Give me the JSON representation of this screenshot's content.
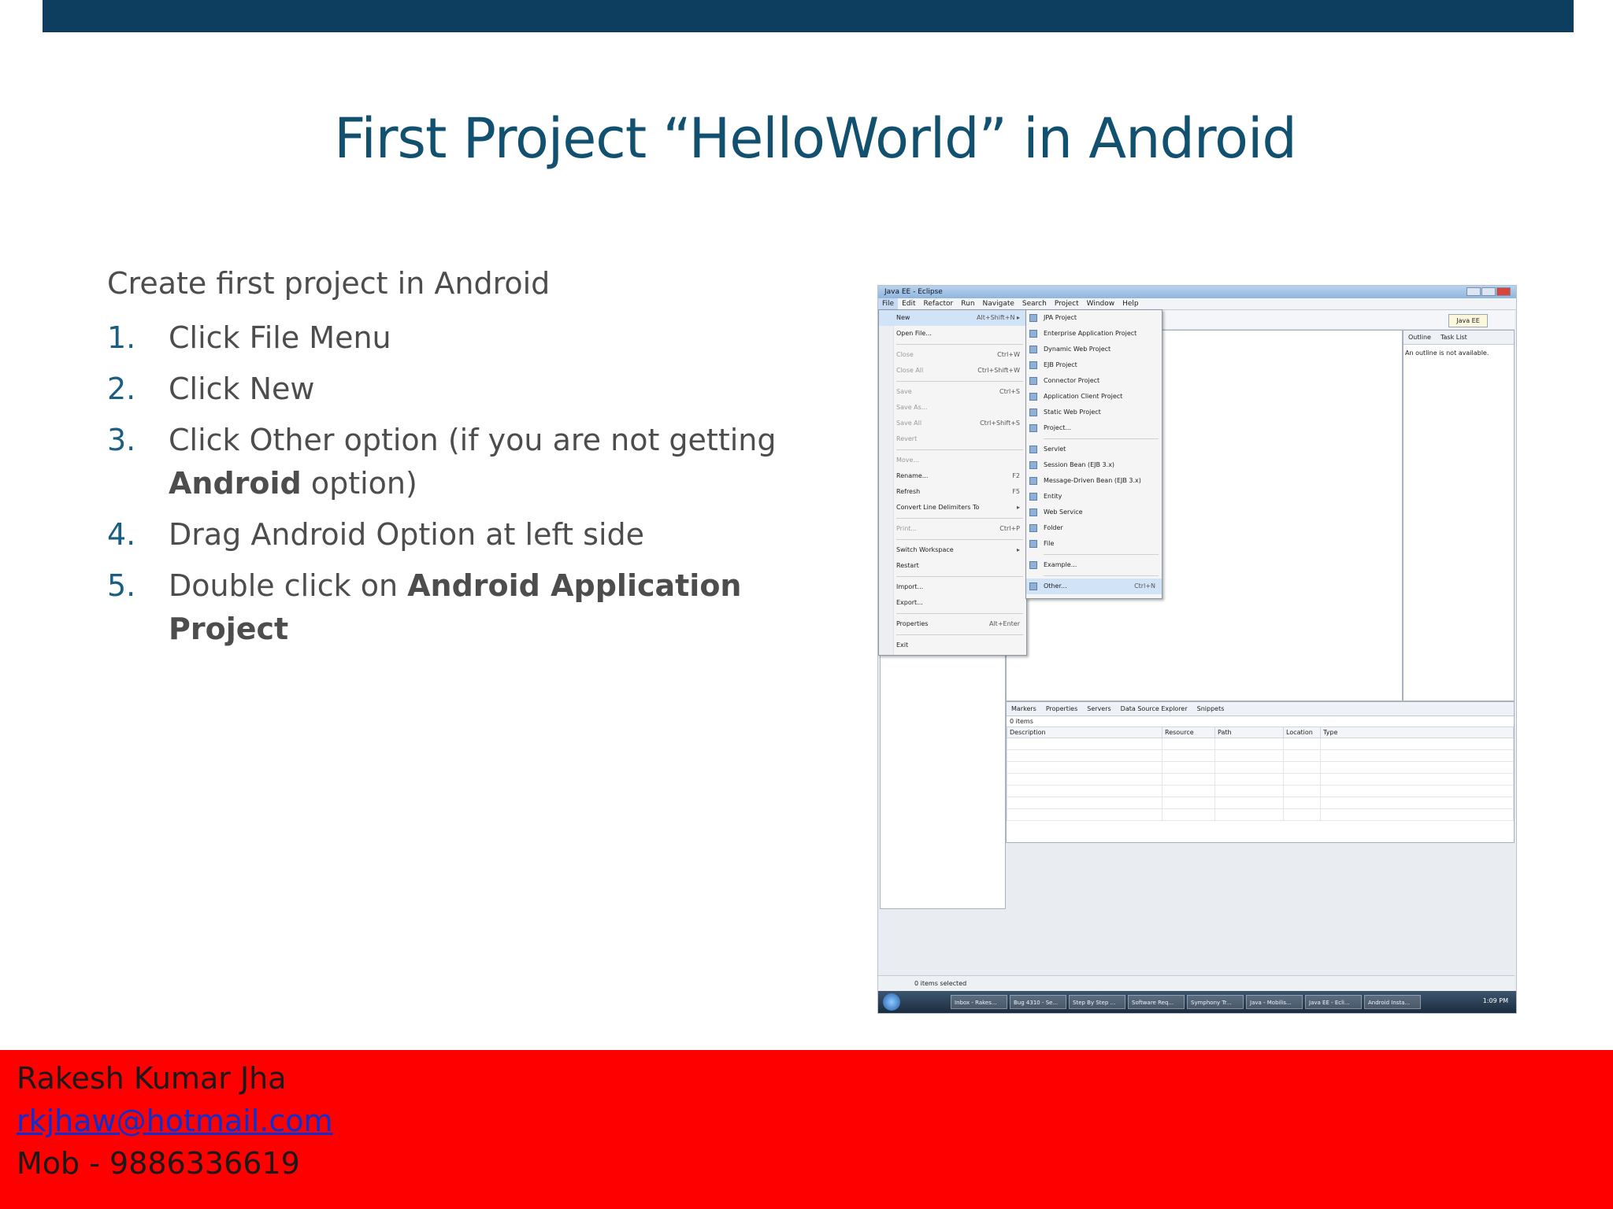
{
  "slide": {
    "title": "First Project “HelloWorld” in Android",
    "intro": "Create first project in Android",
    "steps": [
      {
        "num": "1.",
        "pre": "Click File Menu",
        "bold": "",
        "post": ""
      },
      {
        "num": "2.",
        "pre": "Click New",
        "bold": "",
        "post": ""
      },
      {
        "num": "3.",
        "pre": "Click Other option (if you are not getting ",
        "bold": "Android",
        "post": " option)"
      },
      {
        "num": "4.",
        "pre": "Drag Android Option at left side",
        "bold": "",
        "post": ""
      },
      {
        "num": "5.",
        "pre": "Double click on ",
        "bold": "Android Application Project",
        "post": ""
      }
    ]
  },
  "screenshot": {
    "window_title": "Java EE - Eclipse",
    "menubar": [
      "File",
      "Edit",
      "Refactor",
      "Run",
      "Navigate",
      "Search",
      "Project",
      "Window",
      "Help"
    ],
    "perspective": "Java EE",
    "file_menu": [
      {
        "label": "New",
        "shortcut": "Alt+Shift+N ▸",
        "state": "hl"
      },
      {
        "label": "Open File...",
        "shortcut": "",
        "state": ""
      },
      {
        "sep": true
      },
      {
        "label": "Close",
        "shortcut": "Ctrl+W",
        "state": "dis"
      },
      {
        "label": "Close All",
        "shortcut": "Ctrl+Shift+W",
        "state": "dis"
      },
      {
        "sep": true
      },
      {
        "label": "Save",
        "shortcut": "Ctrl+S",
        "state": "dis"
      },
      {
        "label": "Save As...",
        "shortcut": "",
        "state": "dis"
      },
      {
        "label": "Save All",
        "shortcut": "Ctrl+Shift+S",
        "state": "dis"
      },
      {
        "label": "Revert",
        "shortcut": "",
        "state": "dis"
      },
      {
        "sep": true
      },
      {
        "label": "Move...",
        "shortcut": "",
        "state": "dis"
      },
      {
        "label": "Rename...",
        "shortcut": "F2",
        "state": ""
      },
      {
        "label": "Refresh",
        "shortcut": "F5",
        "state": ""
      },
      {
        "label": "Convert Line Delimiters To",
        "shortcut": "▸",
        "state": ""
      },
      {
        "sep": true
      },
      {
        "label": "Print...",
        "shortcut": "Ctrl+P",
        "state": "dis"
      },
      {
        "sep": true
      },
      {
        "label": "Switch Workspace",
        "shortcut": "▸",
        "state": ""
      },
      {
        "label": "Restart",
        "shortcut": "",
        "state": ""
      },
      {
        "sep": true
      },
      {
        "label": "Import...",
        "shortcut": "",
        "state": ""
      },
      {
        "label": "Export...",
        "shortcut": "",
        "state": ""
      },
      {
        "sep": true
      },
      {
        "label": "Properties",
        "shortcut": "Alt+Enter",
        "state": ""
      },
      {
        "sep": true
      },
      {
        "label": "Exit",
        "shortcut": "",
        "state": ""
      }
    ],
    "new_submenu": [
      {
        "label": "JPA Project",
        "shortcut": ""
      },
      {
        "label": "Enterprise Application Project",
        "shortcut": ""
      },
      {
        "label": "Dynamic Web Project",
        "shortcut": ""
      },
      {
        "label": "EJB Project",
        "shortcut": ""
      },
      {
        "label": "Connector Project",
        "shortcut": ""
      },
      {
        "label": "Application Client Project",
        "shortcut": ""
      },
      {
        "label": "Static Web Project",
        "shortcut": ""
      },
      {
        "label": "Project...",
        "shortcut": ""
      },
      {
        "sep": true
      },
      {
        "label": "Servlet",
        "shortcut": ""
      },
      {
        "label": "Session Bean (EJB 3.x)",
        "shortcut": ""
      },
      {
        "label": "Message-Driven Bean (EJB 3.x)",
        "shortcut": ""
      },
      {
        "label": "Entity",
        "shortcut": ""
      },
      {
        "label": "Web Service",
        "shortcut": ""
      },
      {
        "label": "Folder",
        "shortcut": ""
      },
      {
        "label": "File",
        "shortcut": ""
      },
      {
        "sep": true
      },
      {
        "label": "Example...",
        "shortcut": ""
      },
      {
        "sep": true
      },
      {
        "label": "Other...",
        "shortcut": "Ctrl+N"
      }
    ],
    "outline_tabs": [
      "Outline",
      "Task List"
    ],
    "outline_note": "An outline is not available.",
    "bottom_tabs": [
      "Markers",
      "Properties",
      "Servers",
      "Data Source Explorer",
      "Snippets"
    ],
    "items_count": "0 items",
    "columns": [
      "Description",
      "Resource",
      "Path",
      "Location",
      "Type"
    ],
    "status": "0 items selected",
    "taskbar": [
      "Inbox - Rakes...",
      "Bug 4310 - Se...",
      "Step By Step ...",
      "Software Req...",
      "Symphony Tr...",
      "Java - Mobilis...",
      "Java EE - Ecli...",
      "Android Insta..."
    ],
    "clock": "1:09 PM"
  },
  "footer": {
    "name": "Rakesh Kumar Jha",
    "email": "rkjhaw@hotmail.com",
    "phone": "Mob - 9886336619"
  },
  "colors": {
    "topbar": "#0e3e5f",
    "title": "#11506f",
    "footer": "#ff0000",
    "link": "#0b2fd1"
  }
}
